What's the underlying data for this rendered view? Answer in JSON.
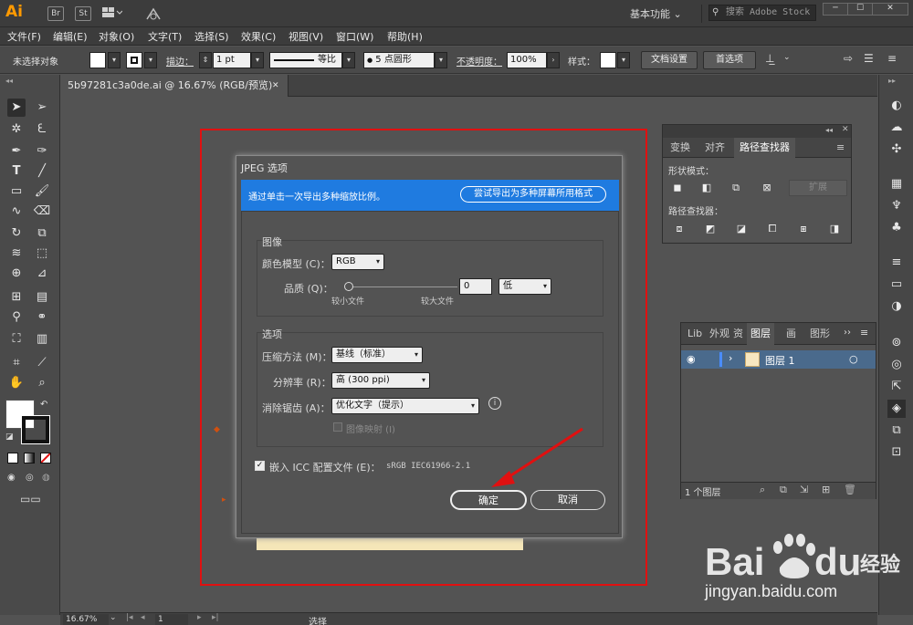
{
  "titlebar": {
    "app_logo": "Ai",
    "br_label": "Br",
    "st_label": "St",
    "workspace": "基本功能",
    "search_placeholder": "搜索 Adobe Stock",
    "window_buttons": [
      "─",
      "☐",
      "✕"
    ]
  },
  "menu": [
    "文件(F)",
    "编辑(E)",
    "对象(O)",
    "文字(T)",
    "选择(S)",
    "效果(C)",
    "视图(V)",
    "窗口(W)",
    "帮助(H)"
  ],
  "control": {
    "selection_status": "未选择对象",
    "stroke_label": "描边：",
    "stroke_value": "1 pt",
    "stroke_profile": "等比",
    "brush_label": "5 点圆形",
    "opacity_label": "不透明度：",
    "opacity_value": "100%",
    "style_label": "样式：",
    "doc_settings": "文档设置",
    "preferences": "首选项"
  },
  "document_tab": {
    "title": "5b97281c3a0de.ai @ 16.67% (RGB/预览)",
    "close": "✕"
  },
  "dialog": {
    "title": "JPEG 选项",
    "banner_text": "通过单击一次导出多种缩放比例。",
    "banner_button": "尝试导出为多种屏幕所用格式",
    "image_group": "图像",
    "color_model_label": "颜色模型 (C)：",
    "color_model_value": "RGB",
    "quality_label": "品质 (Q)：",
    "quality_value": "0",
    "quality_preset": "低",
    "small_file": "较小文件",
    "large_file": "较大文件",
    "options_group": "选项",
    "compression_label": "压缩方法 (M)：",
    "compression_value": "基线（标准）",
    "resolution_label": "分辨率 (R)：",
    "resolution_value": "高 (300 ppi)",
    "antialias_label": "消除锯齿 (A)：",
    "antialias_value": "优化文字（提示）",
    "imagemap_label": "图像映射 (I)",
    "embed_icc_label": "嵌入 ICC 配置文件 (E)：",
    "embed_icc_profile": "sRGB IEC61966-2.1",
    "ok": "确定",
    "cancel": "取消"
  },
  "pathfinder_panel": {
    "tabs": [
      "变换",
      "对齐",
      "路径查找器"
    ],
    "shape_modes_label": "形状模式：",
    "expand_button": "扩展",
    "pathfinders_label": "路径查找器："
  },
  "layers_panel": {
    "tabs": [
      "Lib",
      "外观",
      "资",
      "图层",
      "画",
      "图形"
    ],
    "layer_name": "图层 1",
    "count": "1 个图层"
  },
  "status": {
    "zoom": "16.67%",
    "artboard": "1",
    "tool": "选择"
  },
  "watermark": {
    "brand": "Bai du 经验",
    "url": "jingyan.baidu.com"
  },
  "colors": {
    "accent_blue": "#1f7be0",
    "frame_red": "#e01010",
    "logo_orange": "#ff9a00",
    "layer_row": "#4a6a8c"
  }
}
